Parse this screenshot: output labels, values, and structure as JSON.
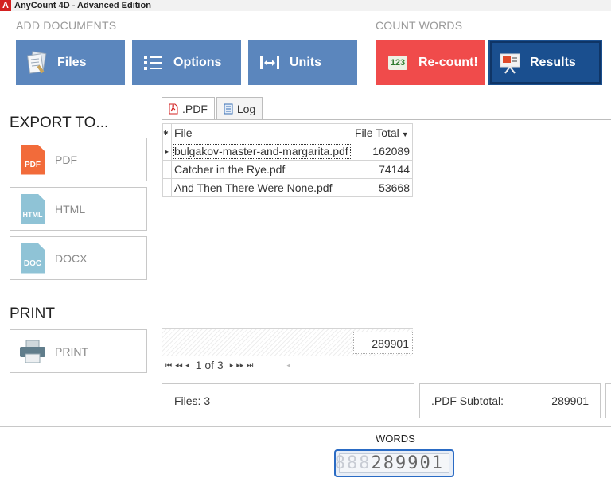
{
  "app": {
    "logo": "A",
    "title": "AnyCount 4D - Advanced Edition"
  },
  "sections": {
    "add_documents": "ADD DOCUMENTS",
    "count_words": "COUNT WORDS"
  },
  "ribbon": {
    "files": "Files",
    "options": "Options",
    "units": "Units",
    "recount": "Re-count!",
    "recount_icon_text": "123",
    "results": "Results"
  },
  "export": {
    "title": "EXPORT TO...",
    "pdf_label": "PDF",
    "pdf_icon_text": "PDF",
    "html_label": "HTML",
    "html_icon_text": "HTML",
    "docx_label": "DOCX",
    "docx_icon_text": "DOC"
  },
  "print": {
    "title": "PRINT",
    "label": "PRINT"
  },
  "tabs": [
    {
      "label": ".PDF"
    },
    {
      "label": "Log"
    }
  ],
  "grid": {
    "col_file": "File",
    "col_total": "File Total",
    "indicator_header": "✱",
    "current_row_indicator": "▸",
    "rows": [
      {
        "file": "bulgakov-master-and-margarita.pdf",
        "total": "162089"
      },
      {
        "file": "Catcher in the Rye.pdf",
        "total": "74144"
      },
      {
        "file": "And Then There Were None.pdf",
        "total": "53668"
      }
    ],
    "sum": "289901",
    "pager": {
      "page_info": "1 of 3"
    }
  },
  "stats": {
    "files": "Files: 3",
    "subtotal_label": ".PDF Subtotal:",
    "subtotal_value": "289901"
  },
  "words": {
    "label": "WORDS",
    "ghost_digits": "888",
    "value": "289901"
  },
  "colors": {
    "ribbon_blue": "#5b86bd",
    "recount_red": "#f04b4b",
    "results_navy": "#1a4f8f",
    "counter_border": "#2a6bc4"
  }
}
